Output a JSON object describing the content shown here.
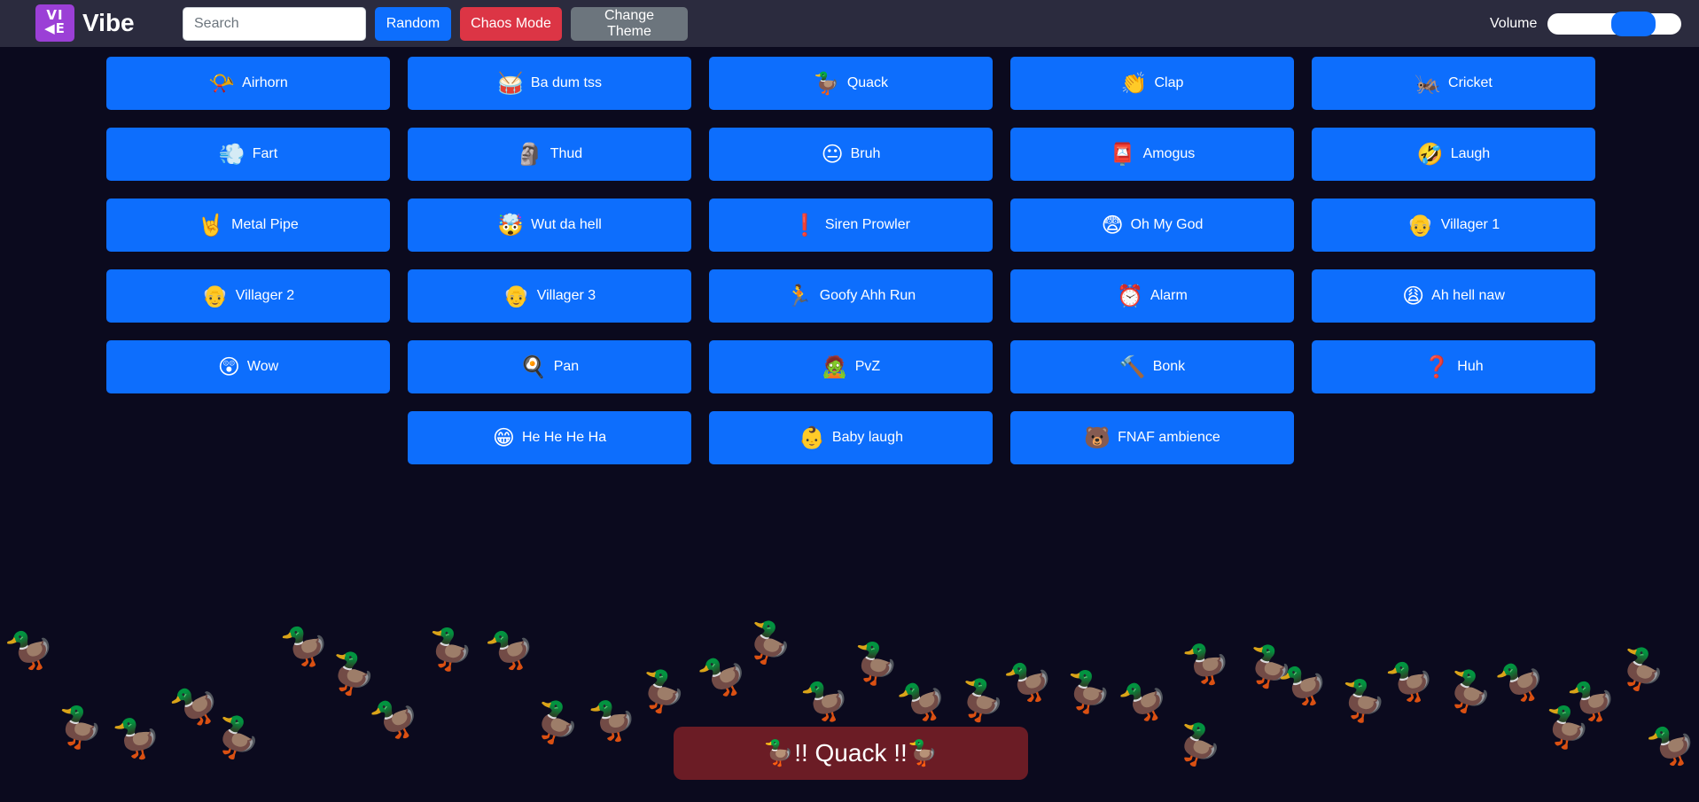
{
  "navbar": {
    "logo_text": "VI\n◀E",
    "brand": "Vibe",
    "search_placeholder": "Search",
    "random_label": "Random",
    "chaos_label": "Chaos Mode",
    "theme_label": "Change Theme",
    "volume_label": "Volume",
    "volume_level": 0.62
  },
  "sounds": [
    {
      "emoji": "📯",
      "label": "Airhorn"
    },
    {
      "emoji": "🥁",
      "label": "Ba dum tss"
    },
    {
      "emoji": "🦆",
      "label": "Quack"
    },
    {
      "emoji": "👏",
      "label": "Clap"
    },
    {
      "emoji": "🦗",
      "label": "Cricket"
    },
    {
      "emoji": "💨",
      "label": "Fart"
    },
    {
      "emoji": "🗿",
      "label": "Thud"
    },
    {
      "emoji": "😐",
      "label": "Bruh"
    },
    {
      "emoji": "📮",
      "label": "Amogus"
    },
    {
      "emoji": "🤣",
      "label": "Laugh"
    },
    {
      "emoji": "🤘",
      "label": "Metal Pipe"
    },
    {
      "emoji": "🤯",
      "label": "Wut da hell"
    },
    {
      "emoji": "❗",
      "label": "Siren Prowler"
    },
    {
      "emoji": "😨",
      "label": "Oh My God"
    },
    {
      "emoji": "👴",
      "label": "Villager 1"
    },
    {
      "emoji": "👴",
      "label": "Villager 2"
    },
    {
      "emoji": "👴",
      "label": "Villager 3"
    },
    {
      "emoji": "🏃",
      "label": "Goofy Ahh Run"
    },
    {
      "emoji": "⏰",
      "label": "Alarm"
    },
    {
      "emoji": "😩",
      "label": "Ah hell naw"
    },
    {
      "emoji": "😲",
      "label": "Wow"
    },
    {
      "emoji": "🍳",
      "label": "Pan"
    },
    {
      "emoji": "🧟",
      "label": "PvZ"
    },
    {
      "emoji": "🔨",
      "label": "Bonk"
    },
    {
      "emoji": "❓",
      "label": "Huh"
    },
    {
      "emoji": "😁",
      "label": "He He He Ha"
    },
    {
      "emoji": "👶",
      "label": "Baby laugh"
    },
    {
      "emoji": "🐻",
      "label": "FNAF ambience"
    }
  ],
  "duck_icon": "duck-icon",
  "toast": "🦆!! Quack !!🦆",
  "colors": {
    "background": "#0b0a1e",
    "navbar": "#2b2b3e",
    "primary": "#0d6efd",
    "danger": "#dc3545",
    "secondary": "#6c757d",
    "logo": "#9b3fd6",
    "toast": "#6b1c25"
  }
}
